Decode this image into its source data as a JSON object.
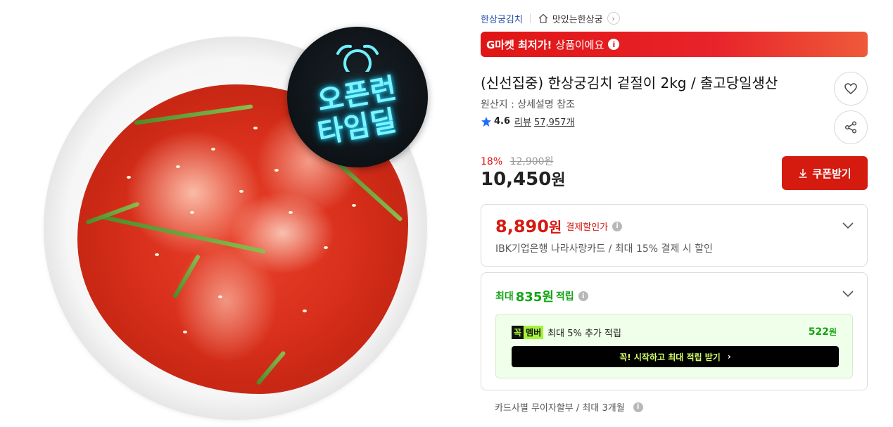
{
  "product_image": {
    "badge_line1": "오픈런",
    "badge_line2": "타임딜"
  },
  "breadcrumb": {
    "brand": "한상궁김치",
    "shop": "맛있는한상궁"
  },
  "promo": {
    "strong": "G마켓 최저가!",
    "text": "상품이에요"
  },
  "product": {
    "title": "(신선집중) 한상궁김치 겉절이 2kg / 출고당일생산",
    "origin": "원산지 : 상세설명 참조",
    "rating": "4.6",
    "review_label": "리뷰",
    "review_count": "57,957개"
  },
  "price": {
    "discount_rate": "18%",
    "original": "12,900원",
    "sale": "10,450",
    "sale_unit": "원"
  },
  "coupon_button": {
    "label": "쿠폰받기"
  },
  "payment_discount": {
    "price": "8,890",
    "unit": "원",
    "label": "결제할인가",
    "description": "IBK기업은행 나라사랑카드 / 최대 15% 결제 시 할인"
  },
  "points": {
    "prefix": "최대",
    "amount": "835원",
    "suffix": "적립",
    "member_badge_left": "꼭",
    "member_badge_right": "멤버",
    "member_text": "최대 5% 추가 적립",
    "member_amount": "522",
    "member_unit": "원",
    "member_cta": "꼭! 시작하고 최대 적립 받기"
  },
  "installment": {
    "text": "카드사별 무이자할부 / 최대 3개월"
  },
  "colors": {
    "accent_red": "#d51a10",
    "brand_blue": "#1f4aa8",
    "point_green": "#13a314",
    "member_lime": "#a6f23a"
  }
}
